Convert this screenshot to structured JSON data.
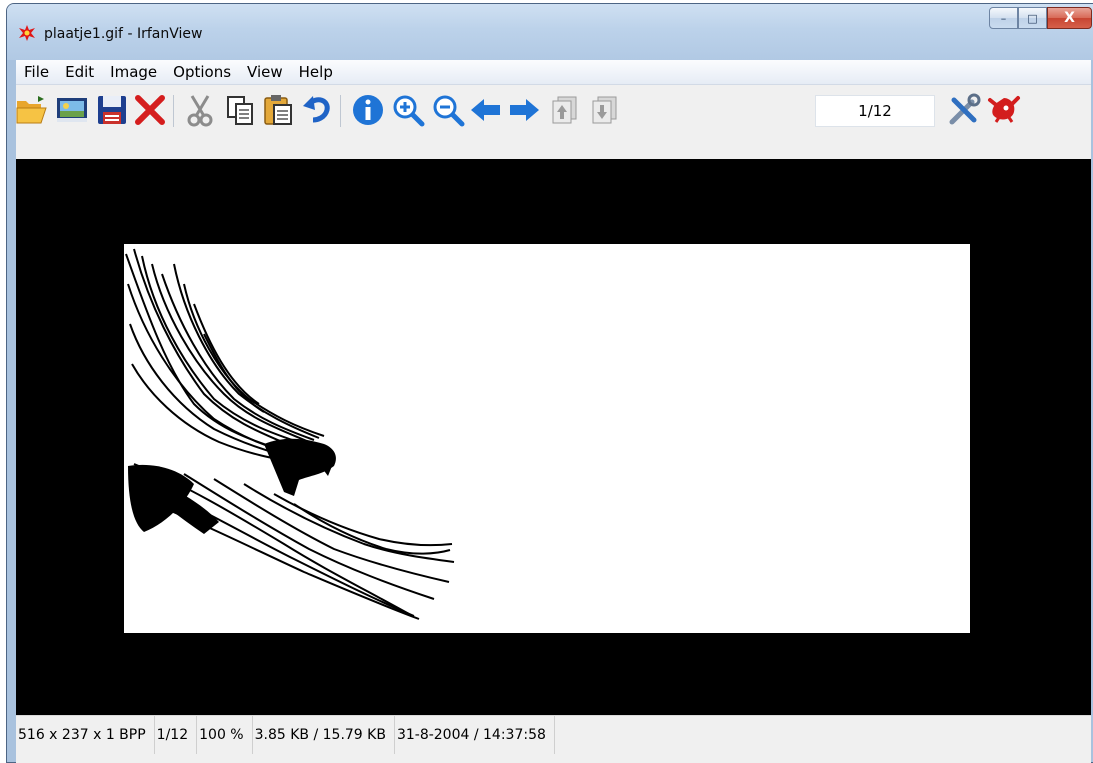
{
  "window": {
    "title": "plaatje1.gif - IrfanView",
    "controls": {
      "minimize": "–",
      "maximize": "□",
      "close": "X"
    }
  },
  "menu": [
    "File",
    "Edit",
    "Image",
    "Options",
    "View",
    "Help"
  ],
  "toolbar": {
    "buttons": [
      {
        "name": "open-icon"
      },
      {
        "name": "thumbnails-icon"
      },
      {
        "name": "save-icon"
      },
      {
        "name": "delete-icon"
      },
      {
        "name": "cut-icon"
      },
      {
        "name": "copy-icon"
      },
      {
        "name": "paste-icon"
      },
      {
        "name": "undo-icon"
      },
      {
        "name": "info-icon"
      },
      {
        "name": "zoom-in-icon"
      },
      {
        "name": "zoom-out-icon"
      },
      {
        "name": "previous-icon"
      },
      {
        "name": "next-icon"
      },
      {
        "name": "previous-page-icon"
      },
      {
        "name": "next-page-icon"
      },
      {
        "name": "properties-icon"
      },
      {
        "name": "exit-icon"
      }
    ],
    "page_indicator": "1/12"
  },
  "colors": {
    "title_bar": "#bcd2ea",
    "view_background": "#000000",
    "image_background": "#ffffff"
  },
  "status": {
    "dimensions": "516 x 237 x 1 BPP",
    "page": "1/12",
    "zoom": "100 %",
    "size": "3.85 KB / 15.79 KB",
    "date": "31-8-2004 / 14:37:58"
  }
}
